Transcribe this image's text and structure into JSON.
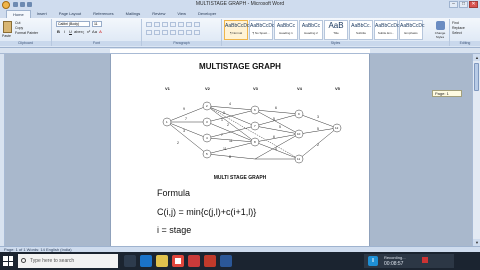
{
  "window": {
    "title": "MULTISTAGE GRAPH - Microsoft Word",
    "controls": [
      "–",
      "□",
      "✕"
    ]
  },
  "ribbon": {
    "tabs": [
      "Home",
      "Insert",
      "Page Layout",
      "References",
      "Mailings",
      "Review",
      "View",
      "Developer"
    ],
    "clipboard": {
      "paste": "Paste",
      "cut": "Cut",
      "copy": "Copy",
      "format_painter": "Format Painter",
      "label": "Clipboard"
    },
    "font": {
      "name": "Calibri (Body)",
      "size": "11",
      "label": "Font",
      "buttons": [
        "B",
        "I",
        "U",
        "abe",
        "x₂",
        "x²",
        "Aa",
        "A"
      ]
    },
    "paragraph": {
      "label": "Paragraph"
    },
    "styles": {
      "label": "Styles",
      "items": [
        {
          "sample": "AaBbCcDc",
          "name": "¶ Normal"
        },
        {
          "sample": "AaBbCcDc",
          "name": "¶ No Spaci..."
        },
        {
          "sample": "AaBbCc",
          "name": "Heading 1"
        },
        {
          "sample": "AaBbCc",
          "name": "Heading 2"
        },
        {
          "sample": "AaB",
          "name": "Title"
        },
        {
          "sample": "AaBbCc.",
          "name": "Subtitle"
        },
        {
          "sample": "AaBbCcDc",
          "name": "Subtle Em..."
        },
        {
          "sample": "AaBbCcDc",
          "name": "Emphasis"
        }
      ],
      "change": "Change Styles"
    },
    "editing": {
      "find": "Find",
      "replace": "Replace",
      "select": "Select",
      "label": "Editing"
    }
  },
  "document": {
    "heading": "MULTISTAGE GRAPH",
    "stage_labels": [
      "V1",
      "V2",
      "V3",
      "V4",
      "V5"
    ],
    "nodes": [
      "1",
      "2",
      "3",
      "4",
      "5",
      "6",
      "7",
      "8",
      "9",
      "10",
      "11",
      "12"
    ],
    "edge_weights": [
      "9",
      "7",
      "3",
      "2",
      "4",
      "2",
      "1",
      "2",
      "7",
      "11",
      "11",
      "8",
      "6",
      "5",
      "5",
      "6",
      "4",
      "3",
      "5",
      "2"
    ],
    "caption": "MULTI STAGE GRAPH",
    "formula_label": "Formula",
    "equation": "C(i,j) = min{c(j,l)+c(i+1,l)}",
    "i_line": "i  = stage"
  },
  "scroll_tip": "Page: 1",
  "status": {
    "left": "Page: 1 of 1   Words: 14   English (India)",
    "right": ""
  },
  "taskbar": {
    "search_placeholder": "Type here to search",
    "recording_label": "Recording...",
    "recording_time": "00:08:57"
  }
}
